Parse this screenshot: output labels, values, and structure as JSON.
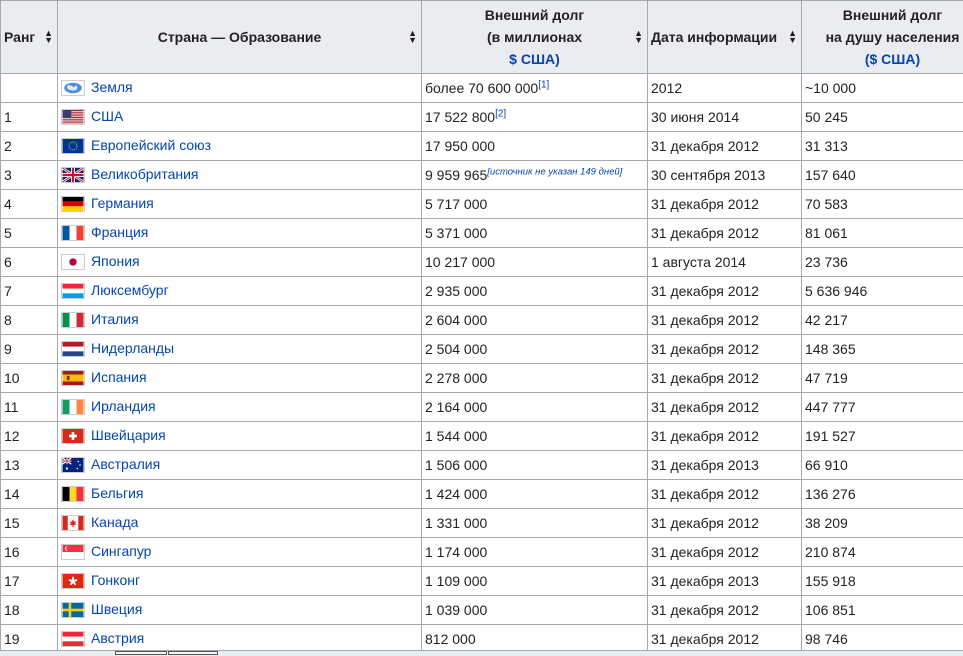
{
  "headers": {
    "rank": "Ранг",
    "country": "Страна — Образование",
    "debt_line1": "Внешний долг",
    "debt_line2": "(в миллионах",
    "debt_line3": "$ США)",
    "date": "Дата информации",
    "percap_line1": "Внешний долг",
    "percap_line2": "на душу населения",
    "percap_line3": "($ США)",
    "sort_icon": "sort-arrows"
  },
  "rows": [
    {
      "rank": "",
      "country": "Земля",
      "flag": "earth",
      "debt": "более 70 600 000",
      "sup": "[1]",
      "date": "2012",
      "percap": "~10 000"
    },
    {
      "rank": "1",
      "country": "США",
      "flag": "usa",
      "debt": "17 522 800",
      "sup": "[2]",
      "date": "30 июня 2014",
      "percap": "50 245"
    },
    {
      "rank": "2",
      "country": "Европейский союз",
      "flag": "eu",
      "debt": "17 950 000",
      "sup": "",
      "date": "31 декабря 2012",
      "percap": "31 313"
    },
    {
      "rank": "3",
      "country": "Великобритания",
      "flag": "uk",
      "debt": "9 959 965",
      "sup": "[источник не указан 149 дней]",
      "date": "30 сентября 2013",
      "percap": "157 640"
    },
    {
      "rank": "4",
      "country": "Германия",
      "flag": "germany",
      "debt": "5 717 000",
      "sup": "",
      "date": "31 декабря 2012",
      "percap": "70 583"
    },
    {
      "rank": "5",
      "country": "Франция",
      "flag": "france",
      "debt": "5 371 000",
      "sup": "",
      "date": "31 декабря 2012",
      "percap": "81 061"
    },
    {
      "rank": "6",
      "country": "Япония",
      "flag": "japan",
      "debt": "10 217 000",
      "sup": "",
      "date": "1 августа 2014",
      "percap": "23 736"
    },
    {
      "rank": "7",
      "country": "Люксембург",
      "flag": "luxembourg",
      "debt": "2 935 000",
      "sup": "",
      "date": "31 декабря 2012",
      "percap": "5 636 946"
    },
    {
      "rank": "8",
      "country": "Италия",
      "flag": "italy",
      "debt": "2 604 000",
      "sup": "",
      "date": "31 декабря 2012",
      "percap": "42 217"
    },
    {
      "rank": "9",
      "country": "Нидерланды",
      "flag": "netherlands",
      "debt": "2 504 000",
      "sup": "",
      "date": "31 декабря 2012",
      "percap": "148 365"
    },
    {
      "rank": "10",
      "country": "Испания",
      "flag": "spain",
      "debt": "2 278 000",
      "sup": "",
      "date": "31 декабря 2012",
      "percap": "47 719"
    },
    {
      "rank": "11",
      "country": "Ирландия",
      "flag": "ireland",
      "debt": "2 164 000",
      "sup": "",
      "date": "31 декабря 2012",
      "percap": "447 777"
    },
    {
      "rank": "12",
      "country": "Швейцария",
      "flag": "switzerland",
      "debt": "1 544 000",
      "sup": "",
      "date": "31 декабря 2012",
      "percap": "191 527"
    },
    {
      "rank": "13",
      "country": "Австралия",
      "flag": "australia",
      "debt": "1 506 000",
      "sup": "",
      "date": "31 декабря 2013",
      "percap": "66 910"
    },
    {
      "rank": "14",
      "country": "Бельгия",
      "flag": "belgium",
      "debt": "1 424 000",
      "sup": "",
      "date": "31 декабря 2012",
      "percap": "136 276"
    },
    {
      "rank": "15",
      "country": "Канада",
      "flag": "canada",
      "debt": "1 331 000",
      "sup": "",
      "date": "31 декабря 2012",
      "percap": "38 209"
    },
    {
      "rank": "16",
      "country": "Сингапур",
      "flag": "singapore",
      "debt": "1 174 000",
      "sup": "",
      "date": "31 декабря 2012",
      "percap": "210 874"
    },
    {
      "rank": "17",
      "country": "Гонконг",
      "flag": "hongkong",
      "debt": "1 109 000",
      "sup": "",
      "date": "31 декабря 2013",
      "percap": "155 918"
    },
    {
      "rank": "18",
      "country": "Швеция",
      "flag": "sweden",
      "debt": "1 039 000",
      "sup": "",
      "date": "31 декабря 2012",
      "percap": "106 851"
    },
    {
      "rank": "19",
      "country": "Австрия",
      "flag": "austria",
      "debt": "812 000",
      "sup": "",
      "date": "31 декабря 2012",
      "percap": "98 746"
    }
  ]
}
